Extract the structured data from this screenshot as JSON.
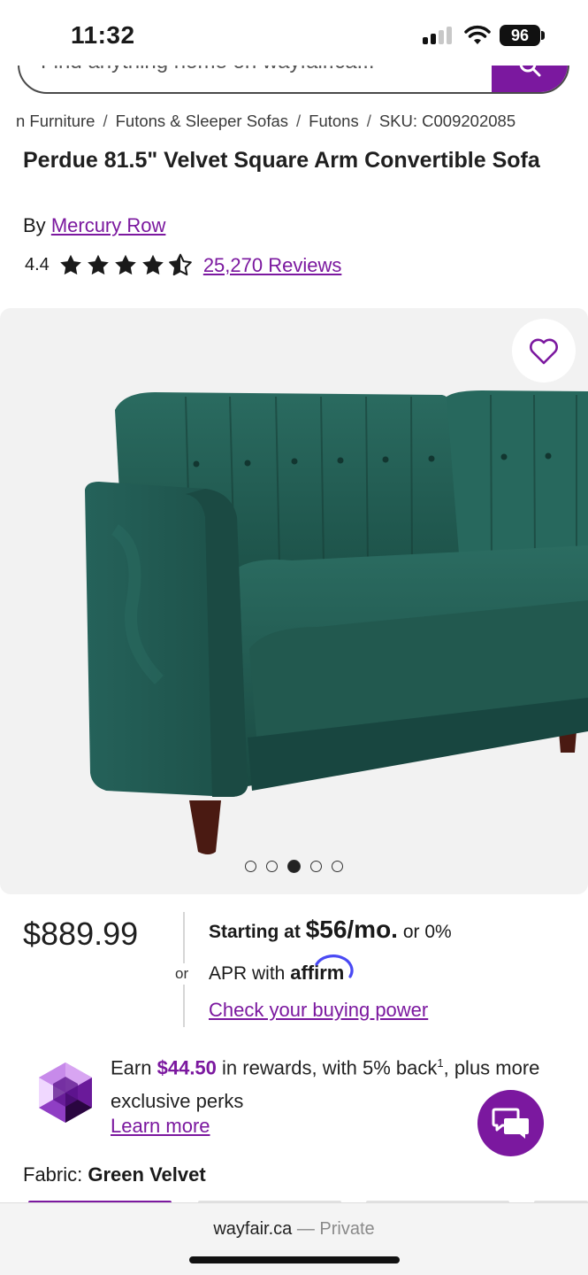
{
  "status": {
    "time": "11:32",
    "battery": "96"
  },
  "search": {
    "placeholder": "Find anything home on wayfair.ca..."
  },
  "breadcrumb": [
    "n Furniture",
    "Futons & Sleeper Sofas",
    "Futons",
    "SKU: C009202085"
  ],
  "product": {
    "title": "Perdue 81.5\" Velvet Square Arm Convertible Sofa",
    "by_label": "By",
    "brand": "Mercury Row",
    "rating": "4.4",
    "stars": 4.4,
    "reviews": "25,270 Reviews",
    "image_count": 5,
    "image_active_index": 2
  },
  "pricing": {
    "price": "$889.99",
    "or": "or",
    "starting_at": "Starting at",
    "monthly": "$56/mo.",
    "or_zero": "or 0%",
    "apr_with": "APR with",
    "affirm": "affirm",
    "check_power": "Check your buying power"
  },
  "rewards": {
    "earn": "Earn",
    "amount": "$44.50",
    "rest": "in rewards, with 5% back",
    "sup": "1",
    "tail": ", plus more exclusive perks",
    "learn_more": "Learn more"
  },
  "fabric": {
    "label": "Fabric:",
    "value": "Green Velvet"
  },
  "browser": {
    "domain": "wayfair.ca",
    "private": "— Private"
  },
  "colors": {
    "brand": "#7b189f",
    "sofa": "#1f5c52"
  }
}
